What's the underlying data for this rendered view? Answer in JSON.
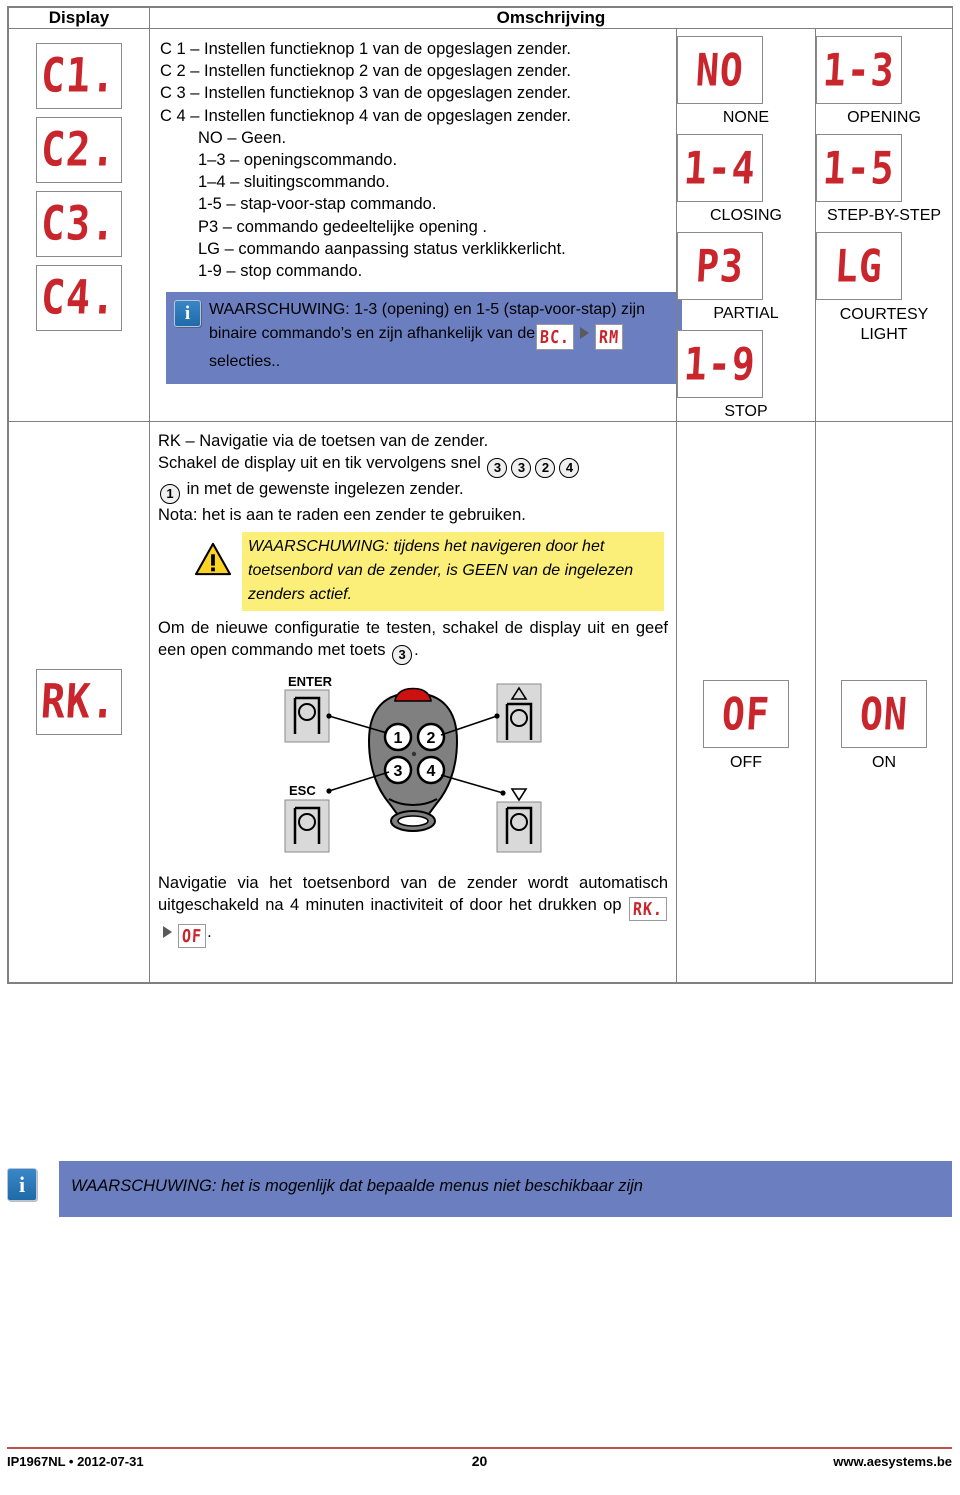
{
  "header": {
    "display_col": "Display",
    "description_col": "Omschrijving"
  },
  "row1": {
    "left_displays": [
      {
        "seg": "C1.",
        "name": "c1"
      },
      {
        "seg": "C2.",
        "name": "c2"
      },
      {
        "seg": "C3.",
        "name": "c3"
      },
      {
        "seg": "C4.",
        "name": "c4"
      }
    ],
    "lines": [
      "C 1 – Instellen functieknop 1 van de opgeslagen zender.",
      "C 2 – Instellen functieknop 2 van de opgeslagen zender.",
      "C 3 – Instellen functieknop 3 van de opgeslagen zender.",
      "C 4 – Instellen functieknop 4 van de opgeslagen zender."
    ],
    "indented_lines": [
      "NO – Geen.",
      "1–3 – openingscommando.",
      "1–4 – sluitingscommando.",
      "1-5 – stap-voor-stap commando.",
      "P3 – commando gedeeltelijke opening .",
      "LG – commando aanpassing status verklikkerlicht.",
      "1-9 – stop commando."
    ],
    "info": {
      "icon": "info-icon",
      "text_part1": "WAARSCHUWING: 1-3 (opening) en 1-5 (stap-voor-stap) zijn binaire commando’s en zijn afhankelijk van de",
      "seg1": "BC.",
      "seg2": "RM",
      "text_part2": "selecties.."
    },
    "right_displays": [
      {
        "seg": "NO",
        "label": "NONE"
      },
      {
        "seg": "1-3",
        "label": "OPENING"
      },
      {
        "seg": "1-4",
        "label": "CLOSING"
      },
      {
        "seg": "1-5",
        "label": "STEP-BY-STEP"
      },
      {
        "seg": "P3",
        "label": "PARTIAL"
      },
      {
        "seg": "LG",
        "label": "COURTESY LIGHT"
      },
      {
        "seg": "1-9",
        "label": "STOP"
      }
    ]
  },
  "row2": {
    "left_display": {
      "seg": "RK."
    },
    "lines": {
      "l1": "RK – Navigatie via de toetsen van de zender.",
      "l2a": "Schakel de display uit en tik vervolgens snel",
      "keys": [
        "3",
        "3",
        "2",
        "4"
      ],
      "l3_key": "1",
      "l3b": "in met de gewenste ingelezen zender.",
      "l4": "Nota: het is aan te raden een zender te gebruiken."
    },
    "warning": {
      "icon": "warning-icon",
      "text": "WAARSCHUWING: tijdens het navigeren door het toetsenbord van de zender, is GEEN van de ingelezen zenders actief."
    },
    "test_text": {
      "a": "Om de nieuwe configuratie te testen, schakel de display uit en geef een open commando met toets",
      "key": "3",
      "b": "."
    },
    "remote": {
      "label_enter": "ENTER",
      "label_esc": "ESC",
      "label_up": "▲",
      "label_down": "▽",
      "buttons": [
        "1",
        "2",
        "3",
        "4"
      ]
    },
    "auto_off": {
      "a": "Navigatie via het toetsenbord van de zender wordt automatisch uitgeschakeld na 4 minuten inactiviteit of door het drukken op",
      "seg1": "RK.",
      "seg2": "OF",
      "b": "."
    },
    "right_displays": [
      {
        "seg": "OF",
        "label": "OFF"
      },
      {
        "seg": "ON",
        "label": "ON"
      }
    ]
  },
  "bottom_bar": {
    "icon": "info-icon",
    "text": "WAARSCHUWING: het is mogenlijk dat bepaalde menus niet beschikbaar zijn"
  },
  "footer": {
    "left": "IP1967NL • 2012-07-31",
    "center": "20",
    "right": "www.aesystems.be"
  },
  "colors": {
    "segment_red": "#c9252c",
    "info_blue": "#6b7fc0",
    "warn_yellow": "#fbef7a",
    "rule_red": "#c0504d"
  }
}
